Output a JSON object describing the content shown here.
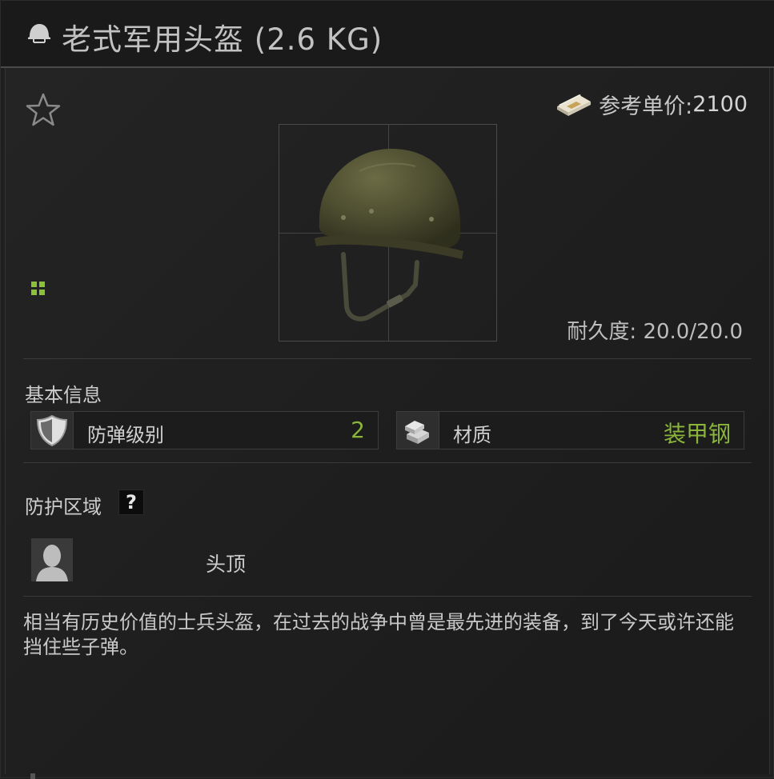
{
  "window": {
    "title": "老式军用头盔 (2.6 KG)"
  },
  "icons": {
    "title": "helmet-icon",
    "favorite": "star-outline-icon",
    "price": "money-stack-icon",
    "grid": "grid-icon",
    "armor_class": "shield-icon",
    "material": "metal-ingots-icon",
    "help": "question-icon",
    "zone": "head-silhouette-icon"
  },
  "price": {
    "label": "参考单价:",
    "value": "2100"
  },
  "durability": {
    "text": "耐久度: 20.0/20.0"
  },
  "basic_info": {
    "title": "基本信息",
    "stats": [
      {
        "label": "防弹级别",
        "value": "2"
      },
      {
        "label": "材质",
        "value": "装甲钢"
      }
    ]
  },
  "protection": {
    "title": "防护区域",
    "help": "?",
    "zones": [
      {
        "label": "头顶"
      }
    ]
  },
  "description": "相当有历史价值的士兵头盔，在过去的战争中曾是最先进的装备，到了今天或许还能挡住些子弹。",
  "colors": {
    "accent_green": "#8ab53a",
    "background": "#1f1f1f",
    "text": "#cfcfcf"
  }
}
